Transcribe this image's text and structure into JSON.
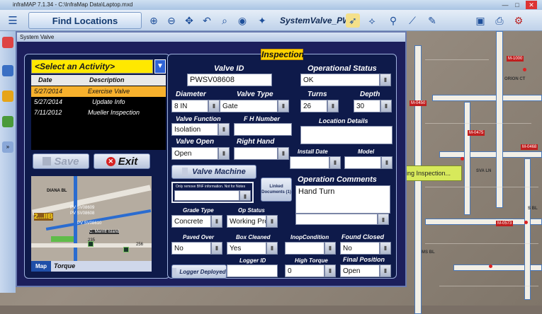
{
  "app": {
    "title": "infraMAP 7.1.34 - C:\\InfraMap Data\\Laptop.mxd",
    "find_label": "Find Locations",
    "layer_label": "SystemValve_PW"
  },
  "dialog": {
    "title": "System Valve"
  },
  "activity": {
    "placeholder": "<Select an Activity>",
    "headers": [
      "Date",
      "Description"
    ],
    "rows": [
      {
        "date": "5/27/2014",
        "desc": "Exercise Valve"
      },
      {
        "date": "5/27/2014",
        "desc": "Update Info"
      },
      {
        "date": "7/11/2012",
        "desc": "Mueller Inspection"
      }
    ]
  },
  "buttons": {
    "save": "Save",
    "exit": "Exit",
    "valve_machine": "Valve Machine",
    "linked_docs": "Linked Documents (1)",
    "logger_deployed": "Logger Deployed"
  },
  "minimap": {
    "tag": "Map",
    "caption": "Torque",
    "labels": {
      "pv1": "PV SV08609",
      "pv2": "PV SV08608",
      "pv3": "PV SV08610",
      "orange": "2...IIB",
      "island": "C. Merritt Island",
      "street": "DIANA BL",
      "n1": "235",
      "n2": "256"
    }
  },
  "inspection": {
    "title": "Inspection",
    "valve_id": {
      "label": "Valve ID",
      "value": "PWSV08608"
    },
    "op_status": {
      "label": "Operational Status",
      "value": "OK"
    },
    "diameter": {
      "label": "Diameter",
      "value": "8 IN"
    },
    "valve_type": {
      "label": "Valve Type",
      "value": "Gate"
    },
    "turns": {
      "label": "Turns",
      "value": "26"
    },
    "depth": {
      "label": "Depth",
      "value": "30"
    },
    "valve_function": {
      "label": "Valve Function",
      "value": "Isolation"
    },
    "fh_number": {
      "label": "F H Number",
      "value": ""
    },
    "location_details": {
      "label": "Location Details",
      "value": ""
    },
    "valve_open": {
      "label": "Valve Open",
      "value": "Open"
    },
    "right_hand": {
      "label": "Right Hand",
      "value": ""
    },
    "install_date": {
      "label": "Install Date",
      "value": ""
    },
    "model": {
      "label": "Model",
      "value": ""
    },
    "bnf_note": "Only remove BNF information. Not for Notes",
    "op_comments": {
      "label": "Operation Comments",
      "value": "Hand Turn"
    },
    "grade_type": {
      "label": "Grade Type",
      "value": "Concrete"
    },
    "op_status2": {
      "label": "Op Status",
      "value": "Working Prop"
    },
    "paved_over": {
      "label": "Paved Over",
      "value": "No"
    },
    "box_cleaned": {
      "label": "Box Cleaned",
      "value": "Yes"
    },
    "inop_condition": {
      "label": "InopCondition",
      "value": ""
    },
    "found_closed": {
      "label": "Found Closed",
      "value": "No"
    },
    "logger_id": {
      "label": "Logger ID",
      "value": ""
    },
    "high_torque": {
      "label": "High Torque",
      "value": "0"
    },
    "final_position": {
      "label": "Final Position",
      "value": "Open"
    }
  },
  "map": {
    "tooltip": "ling Inspection...",
    "labels": {
      "a": "M-0475",
      "b": "M-0450",
      "c": "M-0573",
      "d": "M-1000",
      "e": "M-0468"
    },
    "streets": {
      "orion": "ORION CT",
      "sva": "SVA LN",
      "sbl": "S BL",
      "mbl": "MS BL"
    }
  },
  "colors": {
    "accent": "#ffd200",
    "panel": "#1c1f5c",
    "selected_row": "#f7b12d"
  }
}
